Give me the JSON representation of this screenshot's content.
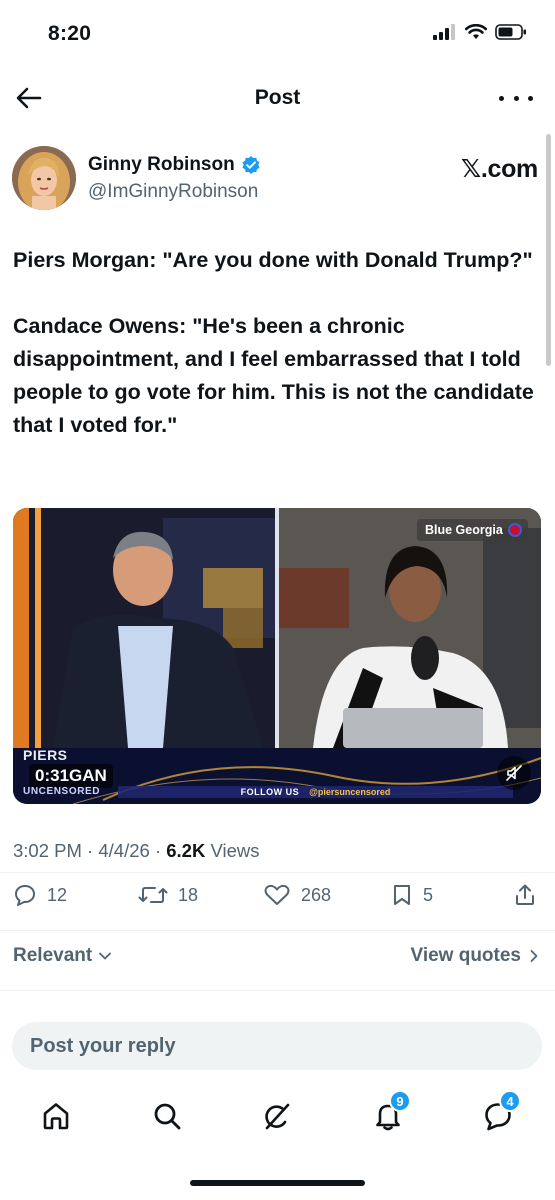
{
  "status_bar": {
    "time": "8:20"
  },
  "header": {
    "title": "Post"
  },
  "author": {
    "name": "Ginny Robinson",
    "handle": "@ImGinnyRobinson",
    "verified": true,
    "source": "𝕏.com"
  },
  "post": {
    "paragraphs": [
      "Piers Morgan: \"Are you done with Donald Trump?\"",
      "Candace Owens: \"He's been a chronic disappointment, and I feel embarrassed that I told people to go vote for him. This is not the candidate that I voted for.\""
    ]
  },
  "video": {
    "channel_badge": "Blue Georgia",
    "show_logo_top": "PIERS",
    "time": "0:31",
    "time_suffix": "GAN",
    "show_logo_bottom": "UNCENSORED",
    "follow_text": "FOLLOW US",
    "follow_handle": "@piersuncensored"
  },
  "meta": {
    "time": "3:02 PM",
    "date": "4/4/26",
    "views_count": "6.2K",
    "views_label": "Views"
  },
  "actions": {
    "replies": "12",
    "reposts": "18",
    "likes": "268",
    "bookmarks": "5"
  },
  "replies_section": {
    "sort_label": "Relevant",
    "view_quotes": "View quotes"
  },
  "reply_box": {
    "placeholder": "Post your reply"
  },
  "bottom_nav": {
    "notifications_badge": "9",
    "messages_badge": "4"
  },
  "colors": {
    "accent": "#1d9bf0",
    "text_primary": "#0f1419",
    "text_secondary": "#536471",
    "reply_background": "#eff3f4"
  }
}
